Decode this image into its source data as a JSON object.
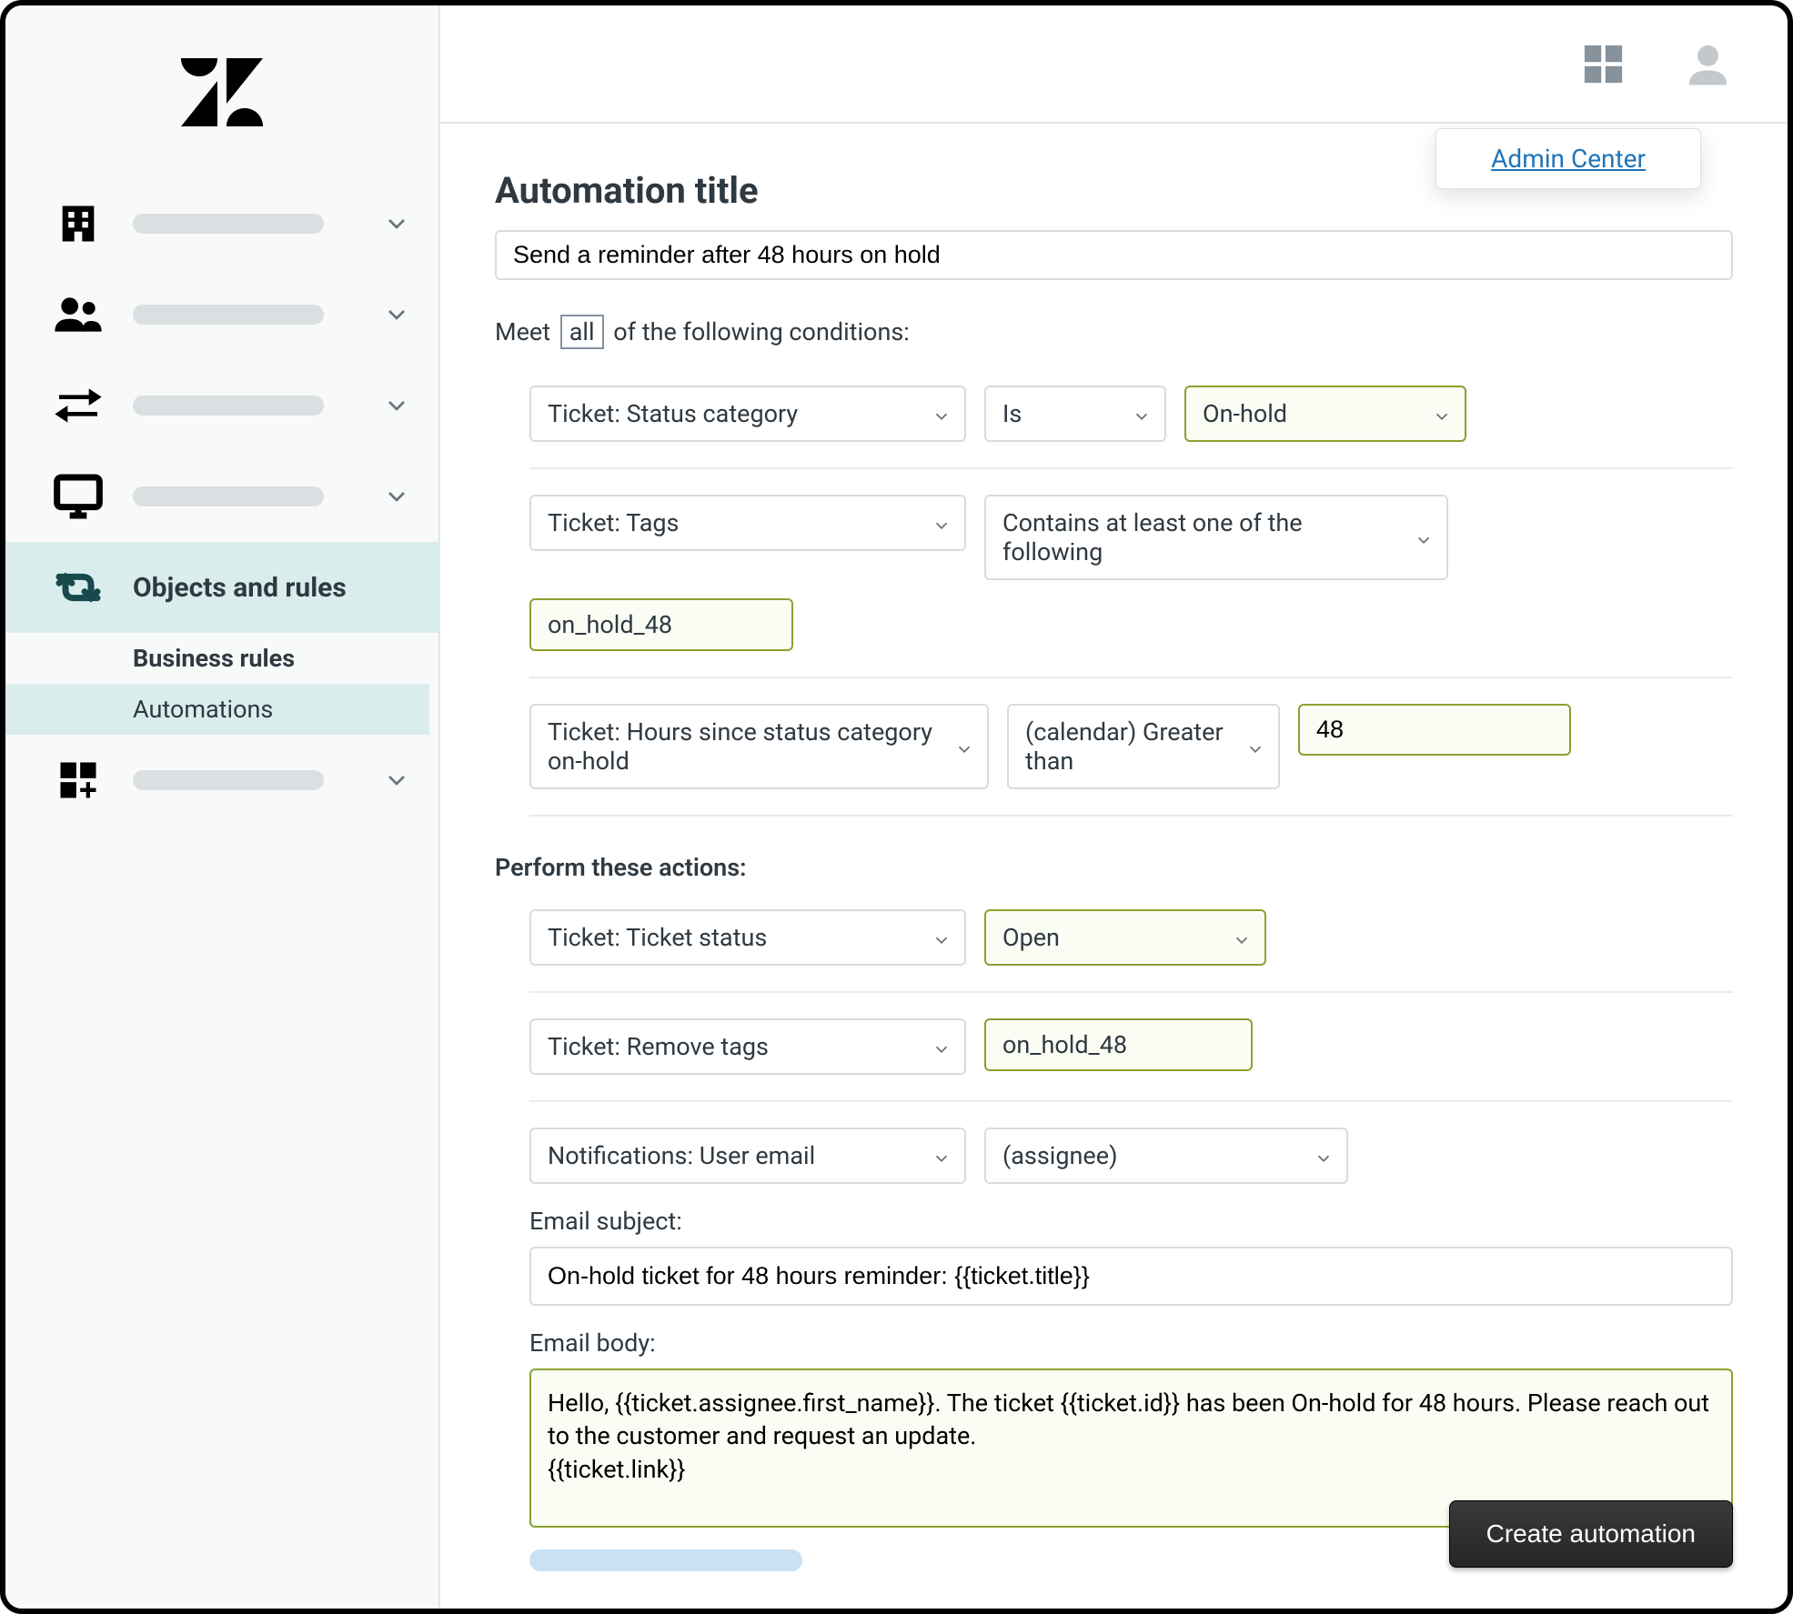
{
  "tooltip": "Admin Center",
  "sidebar": {
    "active_section": "Objects and rules",
    "subitems": [
      "Business rules",
      "Automations"
    ]
  },
  "page": {
    "title_label": "Automation title",
    "title_value": "Send a reminder after 48 hours on hold",
    "meet_prefix": "Meet",
    "meet_mode": "all",
    "meet_suffix": "of the following conditions:",
    "actions_label": "Perform these actions:"
  },
  "conditions": [
    {
      "field": "Ticket: Status category",
      "operator": "Is",
      "value": "On-hold"
    },
    {
      "field": "Ticket: Tags",
      "operator": "Contains at least one of the following",
      "tag_value": "on_hold_48"
    },
    {
      "field": "Ticket: Hours since status category on-hold",
      "operator": "(calendar) Greater than",
      "num_value": "48"
    }
  ],
  "actions": [
    {
      "field": "Ticket: Ticket status",
      "value": "Open"
    },
    {
      "field": "Ticket: Remove tags",
      "tag_value": "on_hold_48"
    },
    {
      "field": "Notifications: User email",
      "value": "(assignee)",
      "email_subject_label": "Email subject:",
      "email_subject": "On-hold ticket for 48 hours reminder: {{ticket.title}}",
      "email_body_label": "Email body:",
      "email_body": "Hello, {{ticket.assignee.first_name}}. The ticket {{ticket.id}} has been On-hold for 48 hours. Please reach out to the customer and request an update.\n{{ticket.link}}"
    }
  ],
  "button": "Create automation"
}
